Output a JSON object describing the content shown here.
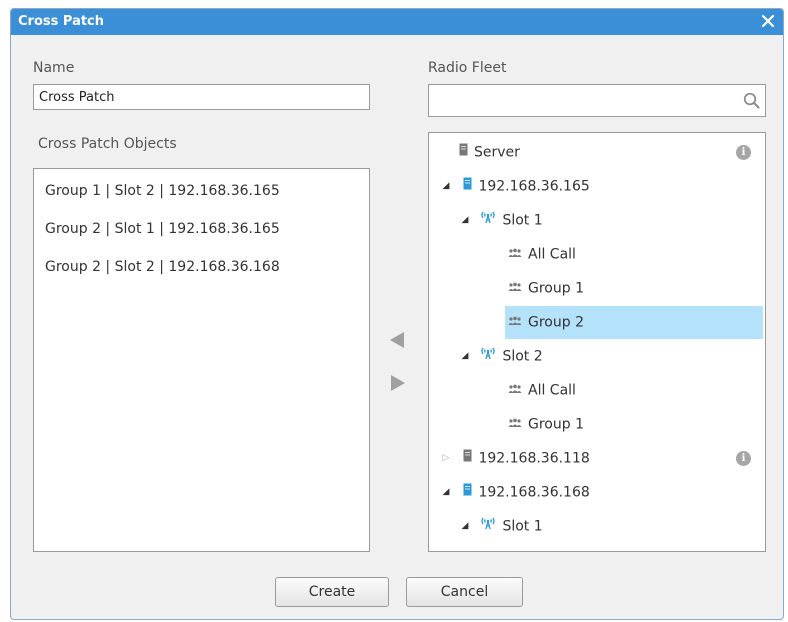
{
  "window": {
    "title": "Cross Patch",
    "close_icon": "close-icon"
  },
  "name": {
    "label": "Name",
    "value": "Cross Patch"
  },
  "objects": {
    "label": "Cross Patch Objects",
    "items": [
      "Group 1 | Slot 2 | 192.168.36.165",
      "Group 2 | Slot 1 | 192.168.36.165",
      "Group 2 | Slot 2 | 192.168.36.168"
    ]
  },
  "fleet": {
    "label": "Radio Fleet",
    "search_value": "",
    "tree": [
      {
        "label": "Server",
        "icon": "server-icon",
        "info": true
      },
      {
        "label": "192.168.36.165",
        "icon": "repeater-icon",
        "expander": "expanded"
      },
      {
        "label": "Slot 1",
        "icon": "antenna-icon",
        "expander": "expanded"
      },
      {
        "label": "All Call",
        "icon": "group-icon"
      },
      {
        "label": "Group 1",
        "icon": "group-icon"
      },
      {
        "label": "Group 2",
        "icon": "group-icon",
        "selected": true
      },
      {
        "label": "Slot 2",
        "icon": "antenna-icon",
        "expander": "expanded"
      },
      {
        "label": "All Call",
        "icon": "group-icon"
      },
      {
        "label": "Group 1",
        "icon": "group-icon"
      },
      {
        "label": "192.168.36.118",
        "icon": "repeater-offline-icon",
        "expander": "collapsed",
        "info": true
      },
      {
        "label": "192.168.36.168",
        "icon": "repeater-icon",
        "expander": "expanded"
      },
      {
        "label": "Slot 1",
        "icon": "antenna-icon",
        "expander": "expanded"
      }
    ]
  },
  "buttons": {
    "create": "Create",
    "cancel": "Cancel"
  },
  "colors": {
    "titlebar": "#3a8fd6",
    "selection": "#b5e2fb",
    "device_online": "#2a9ad8",
    "device_offline": "#777777"
  }
}
